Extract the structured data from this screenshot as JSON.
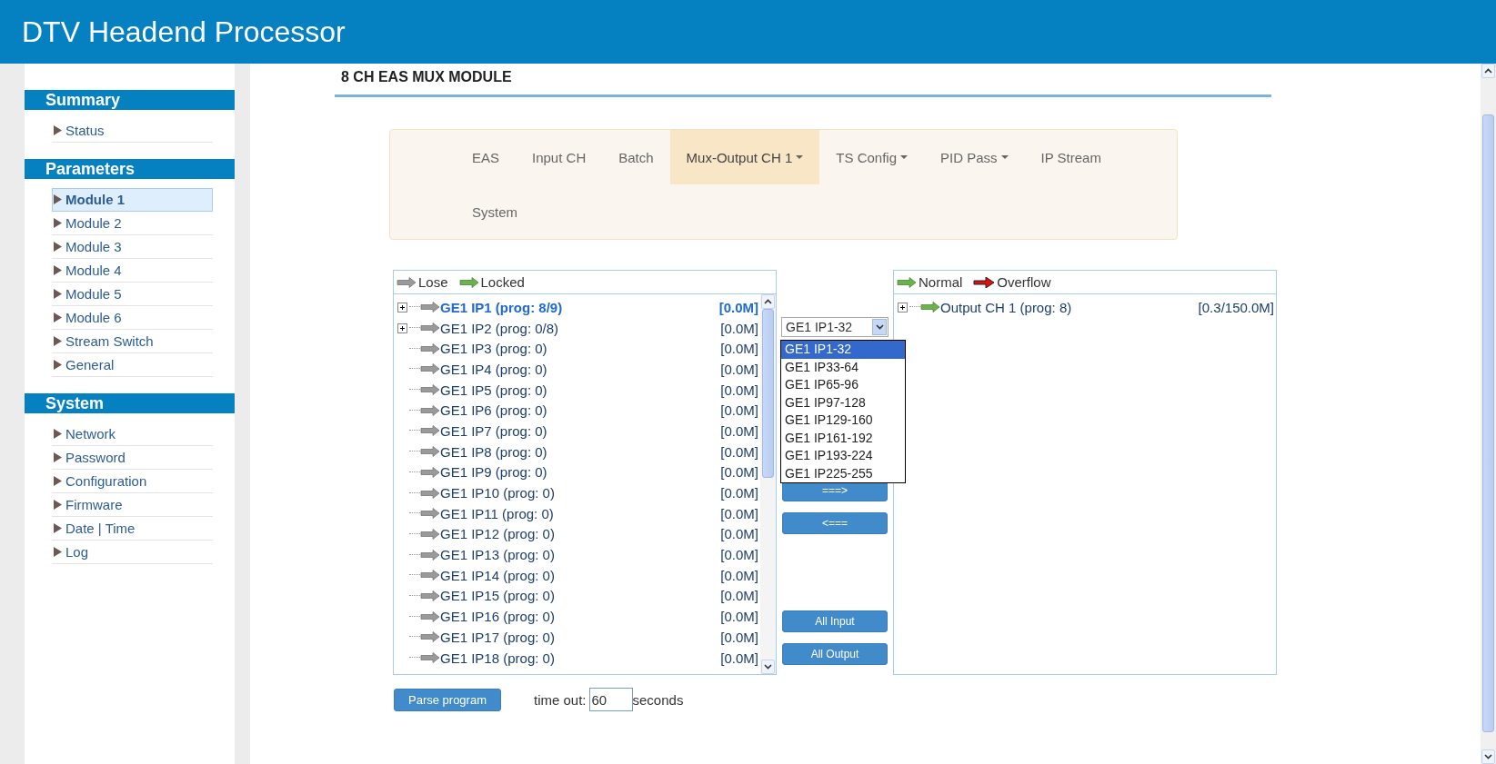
{
  "header": {
    "title": "DTV Headend Processor"
  },
  "sidebar": {
    "sections": [
      {
        "title": "Summary",
        "items": [
          {
            "label": "Status",
            "selected": false
          }
        ]
      },
      {
        "title": "Parameters",
        "items": [
          {
            "label": "Module 1",
            "selected": true
          },
          {
            "label": "Module 2",
            "selected": false
          },
          {
            "label": "Module 3",
            "selected": false
          },
          {
            "label": "Module 4",
            "selected": false
          },
          {
            "label": "Module 5",
            "selected": false
          },
          {
            "label": "Module 6",
            "selected": false
          },
          {
            "label": "Stream Switch",
            "selected": false
          },
          {
            "label": "General",
            "selected": false
          }
        ]
      },
      {
        "title": "System",
        "items": [
          {
            "label": "Network",
            "selected": false
          },
          {
            "label": "Password",
            "selected": false
          },
          {
            "label": "Configuration",
            "selected": false
          },
          {
            "label": "Firmware",
            "selected": false
          },
          {
            "label": "Date | Time",
            "selected": false
          },
          {
            "label": "Log",
            "selected": false
          }
        ]
      }
    ]
  },
  "content": {
    "title": "8 CH EAS MUX MODULE"
  },
  "tabs": [
    {
      "label": "EAS",
      "selected": false,
      "has_menu": false
    },
    {
      "label": "Input CH",
      "selected": false,
      "has_menu": false
    },
    {
      "label": "Batch",
      "selected": false,
      "has_menu": false
    },
    {
      "label": "Mux-Output CH 1",
      "selected": true,
      "has_menu": true
    },
    {
      "label": "TS Config",
      "selected": false,
      "has_menu": true
    },
    {
      "label": "PID Pass",
      "selected": false,
      "has_menu": true
    },
    {
      "label": "IP Stream",
      "selected": false,
      "has_menu": false
    },
    {
      "label": "System",
      "selected": false,
      "has_menu": false
    }
  ],
  "input_panel": {
    "legend": [
      {
        "label": "Lose",
        "kind": "lose"
      },
      {
        "label": "Locked",
        "kind": "locked"
      }
    ],
    "items": [
      {
        "label": "GE1 IP1 (prog: 8/9)",
        "rate": "[0.0M]",
        "kind": "lose",
        "expandable": true,
        "selected": true
      },
      {
        "label": "GE1 IP2 (prog: 0/8)",
        "rate": "[0.0M]",
        "kind": "lose",
        "expandable": true,
        "selected": false
      },
      {
        "label": "GE1 IP3 (prog: 0)",
        "rate": "[0.0M]",
        "kind": "lose",
        "expandable": false,
        "selected": false
      },
      {
        "label": "GE1 IP4 (prog: 0)",
        "rate": "[0.0M]",
        "kind": "lose",
        "expandable": false,
        "selected": false
      },
      {
        "label": "GE1 IP5 (prog: 0)",
        "rate": "[0.0M]",
        "kind": "lose",
        "expandable": false,
        "selected": false
      },
      {
        "label": "GE1 IP6 (prog: 0)",
        "rate": "[0.0M]",
        "kind": "lose",
        "expandable": false,
        "selected": false
      },
      {
        "label": "GE1 IP7 (prog: 0)",
        "rate": "[0.0M]",
        "kind": "lose",
        "expandable": false,
        "selected": false
      },
      {
        "label": "GE1 IP8 (prog: 0)",
        "rate": "[0.0M]",
        "kind": "lose",
        "expandable": false,
        "selected": false
      },
      {
        "label": "GE1 IP9 (prog: 0)",
        "rate": "[0.0M]",
        "kind": "lose",
        "expandable": false,
        "selected": false
      },
      {
        "label": "GE1 IP10 (prog: 0)",
        "rate": "[0.0M]",
        "kind": "lose",
        "expandable": false,
        "selected": false
      },
      {
        "label": "GE1 IP11 (prog: 0)",
        "rate": "[0.0M]",
        "kind": "lose",
        "expandable": false,
        "selected": false
      },
      {
        "label": "GE1 IP12 (prog: 0)",
        "rate": "[0.0M]",
        "kind": "lose",
        "expandable": false,
        "selected": false
      },
      {
        "label": "GE1 IP13 (prog: 0)",
        "rate": "[0.0M]",
        "kind": "lose",
        "expandable": false,
        "selected": false
      },
      {
        "label": "GE1 IP14 (prog: 0)",
        "rate": "[0.0M]",
        "kind": "lose",
        "expandable": false,
        "selected": false
      },
      {
        "label": "GE1 IP15 (prog: 0)",
        "rate": "[0.0M]",
        "kind": "lose",
        "expandable": false,
        "selected": false
      },
      {
        "label": "GE1 IP16 (prog: 0)",
        "rate": "[0.0M]",
        "kind": "lose",
        "expandable": false,
        "selected": false
      },
      {
        "label": "GE1 IP17 (prog: 0)",
        "rate": "[0.0M]",
        "kind": "lose",
        "expandable": false,
        "selected": false
      },
      {
        "label": "GE1 IP18 (prog: 0)",
        "rate": "[0.0M]",
        "kind": "lose",
        "expandable": false,
        "selected": false
      }
    ]
  },
  "range_select": {
    "value": "GE1 IP1-32",
    "options": [
      {
        "label": "GE1 IP1-32",
        "selected": true
      },
      {
        "label": "GE1 IP33-64",
        "selected": false
      },
      {
        "label": "GE1 IP65-96",
        "selected": false
      },
      {
        "label": "GE1 IP97-128",
        "selected": false
      },
      {
        "label": "GE1 IP129-160",
        "selected": false
      },
      {
        "label": "GE1 IP161-192",
        "selected": false
      },
      {
        "label": "GE1 IP193-224",
        "selected": false
      },
      {
        "label": "GE1 IP225-255",
        "selected": false
      }
    ]
  },
  "move_buttons": [
    "===>",
    "<==="
  ],
  "bulk_buttons": [
    "All Input",
    "All Output"
  ],
  "output_panel": {
    "legend": [
      {
        "label": "Normal",
        "kind": "normal"
      },
      {
        "label": "Overflow",
        "kind": "overflow"
      }
    ],
    "items": [
      {
        "label": "Output CH 1 (prog: 8)",
        "rate": "[0.3/150.0M]",
        "kind": "normal",
        "expandable": true,
        "selected": false
      }
    ]
  },
  "parse": {
    "button": "Parse program",
    "timeout_label": "time out:",
    "timeout_value": "60",
    "unit": "seconds"
  }
}
